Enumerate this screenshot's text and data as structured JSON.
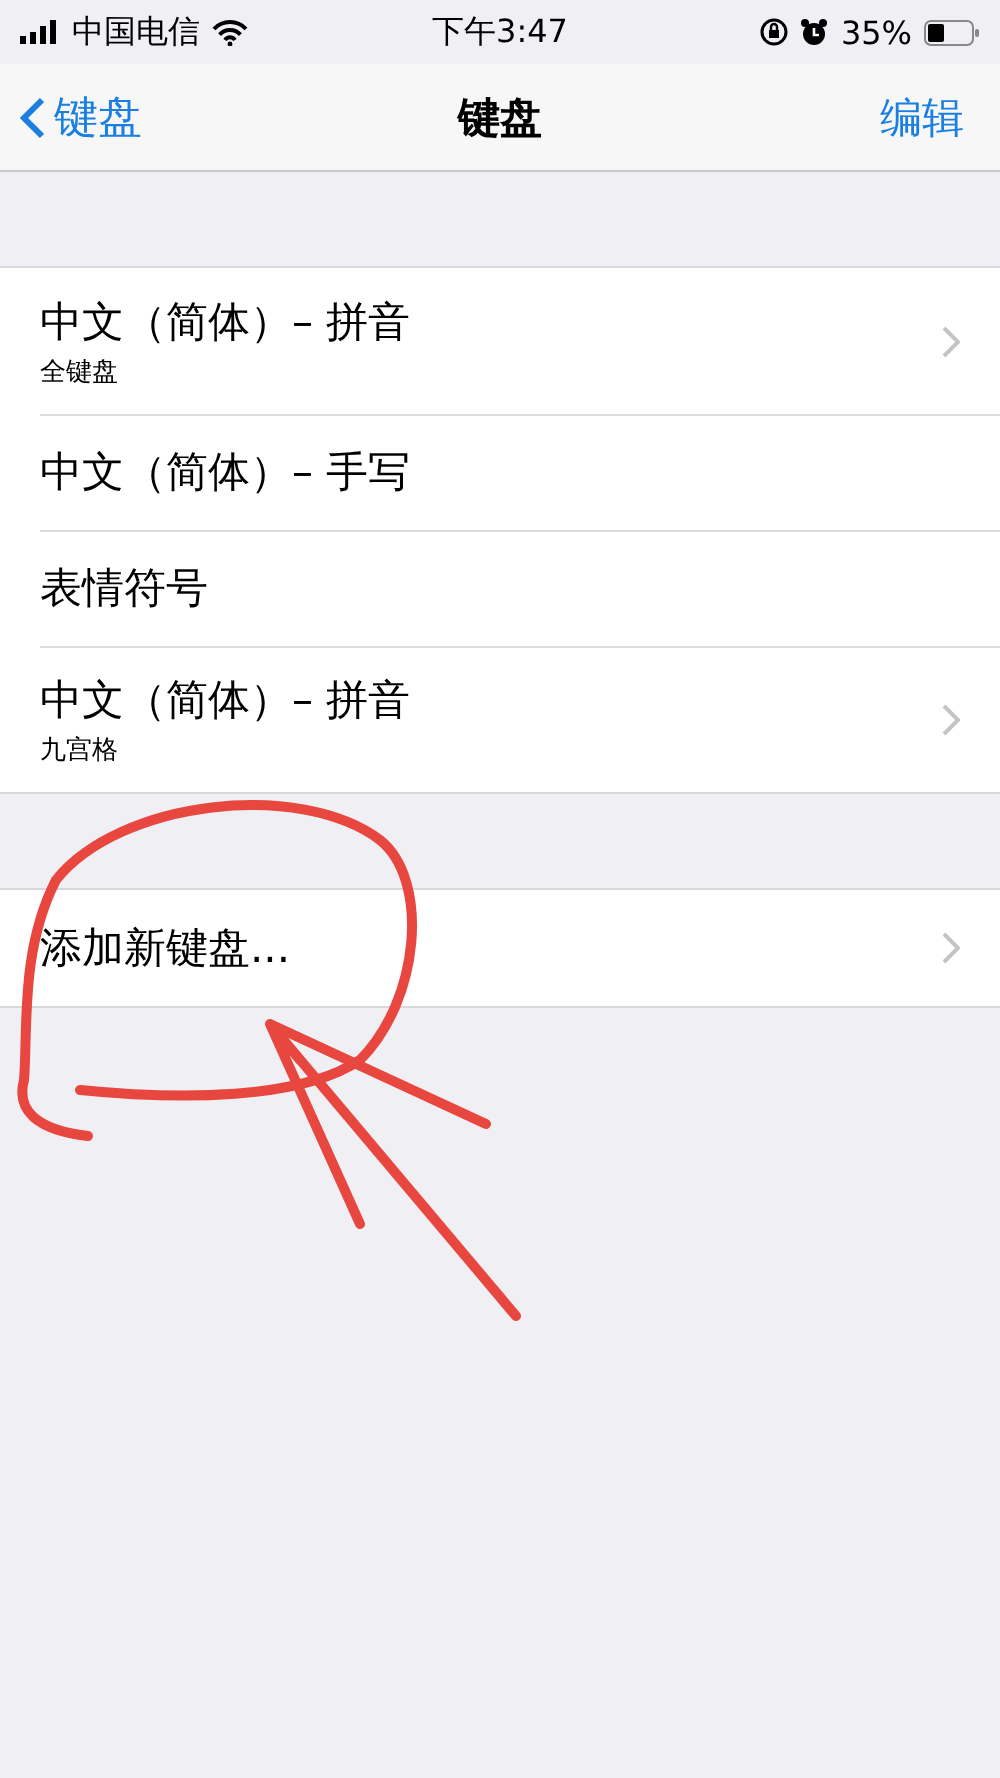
{
  "status_bar": {
    "carrier": "中国电信",
    "time": "下午3:47",
    "battery": "35%"
  },
  "nav": {
    "back": "键盘",
    "title": "键盘",
    "action": "编辑"
  },
  "sections": [
    {
      "rows": [
        {
          "label": "中文（简体）– 拼音",
          "subtitle": "全键盘",
          "chevron": true
        },
        {
          "label": "中文（简体）– 手写",
          "chevron": false
        },
        {
          "label": "表情符号",
          "chevron": false
        },
        {
          "label": "中文（简体）– 拼音",
          "subtitle": "九宫格",
          "chevron": true
        }
      ]
    },
    {
      "rows": [
        {
          "label": "添加新键盘...",
          "chevron": true
        }
      ]
    }
  ]
}
